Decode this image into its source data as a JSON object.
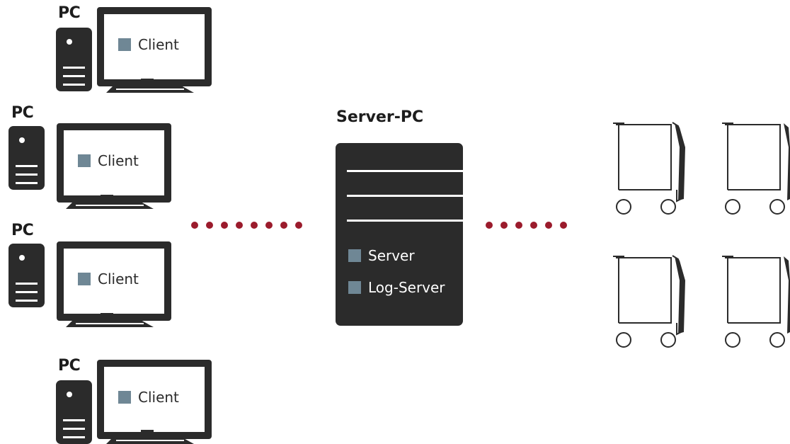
{
  "clients": [
    {
      "pc_label": "PC",
      "app_label": "Client"
    },
    {
      "pc_label": "PC",
      "app_label": "Client"
    },
    {
      "pc_label": "PC",
      "app_label": "Client"
    },
    {
      "pc_label": "PC",
      "app_label": "Client"
    }
  ],
  "server": {
    "title": "Server-PC",
    "services": [
      "Server",
      "Log-Server"
    ]
  },
  "colors": {
    "dark": "#2b2b2b",
    "service_square": "#6f8795",
    "connector_dots": "#9b1b2c"
  },
  "icons": {
    "pc": "desktop-computer-icon",
    "server": "server-tower-icon",
    "device": "cart-device-icon"
  }
}
